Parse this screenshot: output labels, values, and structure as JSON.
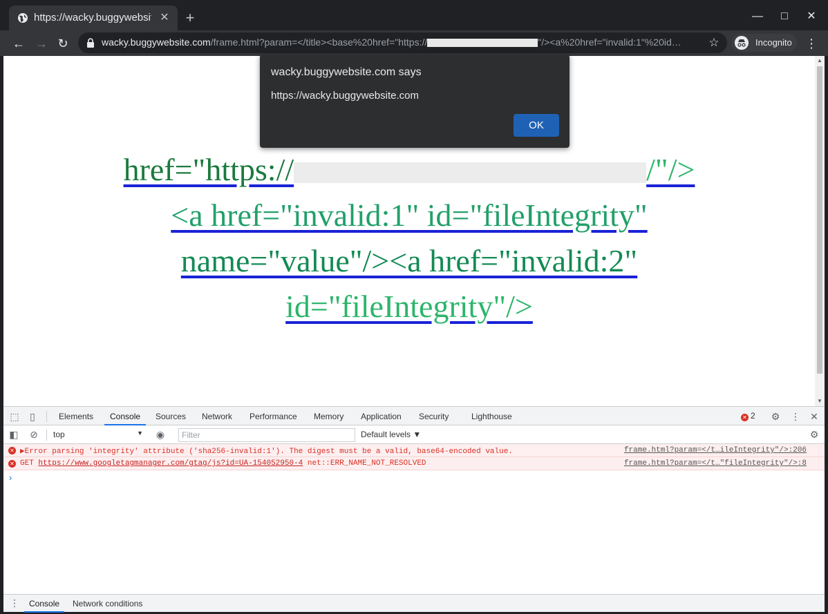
{
  "browser": {
    "tab_title": "https://wacky.buggywebsite.com",
    "new_tab": "+",
    "minimize": "—",
    "maximize": "□",
    "close": "✕",
    "url_host": "wacky.buggywebsite.com",
    "url_path_a": "/frame.html?param=</title><base%20href=\"https://",
    "url_path_b": "\"/><a%20href=\"invalid:1\"%20id…",
    "incognito_label": "Incognito"
  },
  "page": {
    "line1_a": "href=\"https://",
    "line1_b": "/\"/>",
    "line2": "<a href=\"invalid:1\" id=\"fileIntegrity\"",
    "line3": "name=\"value\"/><a href=\"invalid:2\"",
    "line4": "id=\"fileIntegrity\"/>"
  },
  "alert": {
    "title": "wacky.buggywebsite.com says",
    "message": "https://wacky.buggywebsite.com",
    "ok_label": "OK"
  },
  "devtools": {
    "tabs": [
      "Elements",
      "Console",
      "Sources",
      "Network",
      "Performance",
      "Memory",
      "Application",
      "Security",
      "Lighthouse"
    ],
    "active_tab": "Console",
    "error_count": "2",
    "context": "top",
    "filter_placeholder": "Filter",
    "levels": "Default levels ▼",
    "logs": [
      {
        "message": "▶Error parsing 'integrity' attribute ('sha256-invalid:1'). The digest must be a valid, base64-encoded value.",
        "source": "frame.html?param=</t…ileIntegrity\"/>:206"
      },
      {
        "method": "GET",
        "url": "https://www.googletagmanager.com/gtag/js?id=UA-154052950-4",
        "error": "net::ERR_NAME_NOT_RESOLVED",
        "source": "frame.html?param=</t…\"fileIntegrity\"/>:8"
      }
    ],
    "prompt": "›",
    "drawer_tabs": [
      "Console",
      "Network conditions"
    ]
  }
}
